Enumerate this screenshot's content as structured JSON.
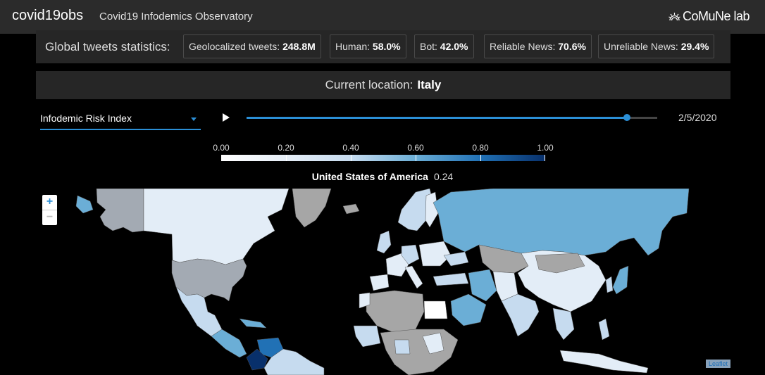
{
  "header": {
    "brand": "covid19obs",
    "subtitle": "Covid19 Infodemics Observatory",
    "org": "CoMuNe lab"
  },
  "stats": {
    "label": "Global tweets statistics:",
    "items": [
      {
        "label": "Geolocalized tweets:",
        "value": "248.8M"
      },
      {
        "label": "Human:",
        "value": "58.0%"
      },
      {
        "label": "Bot:",
        "value": "42.0%"
      },
      {
        "label": "Reliable News:",
        "value": "70.6%"
      },
      {
        "label": "Unreliable News:",
        "value": "29.4%"
      }
    ]
  },
  "location": {
    "label": "Current location:",
    "value": "Italy"
  },
  "controls": {
    "metric_select": "Infodemic Risk Index",
    "slider_position": 0.927,
    "date": "2/5/2020"
  },
  "scale": {
    "ticks": [
      "0.00",
      "0.20",
      "0.40",
      "0.60",
      "0.80",
      "1.00"
    ]
  },
  "hover": {
    "country": "United States of America",
    "value": "0.24"
  },
  "map": {
    "zoom_in": "+",
    "zoom_out": "−",
    "attribution": "Leaflet"
  },
  "colors": {
    "accent": "#2b8fd6",
    "no_data": "#a6a6a6",
    "low": "#e3edf7",
    "high": "#08306b"
  }
}
